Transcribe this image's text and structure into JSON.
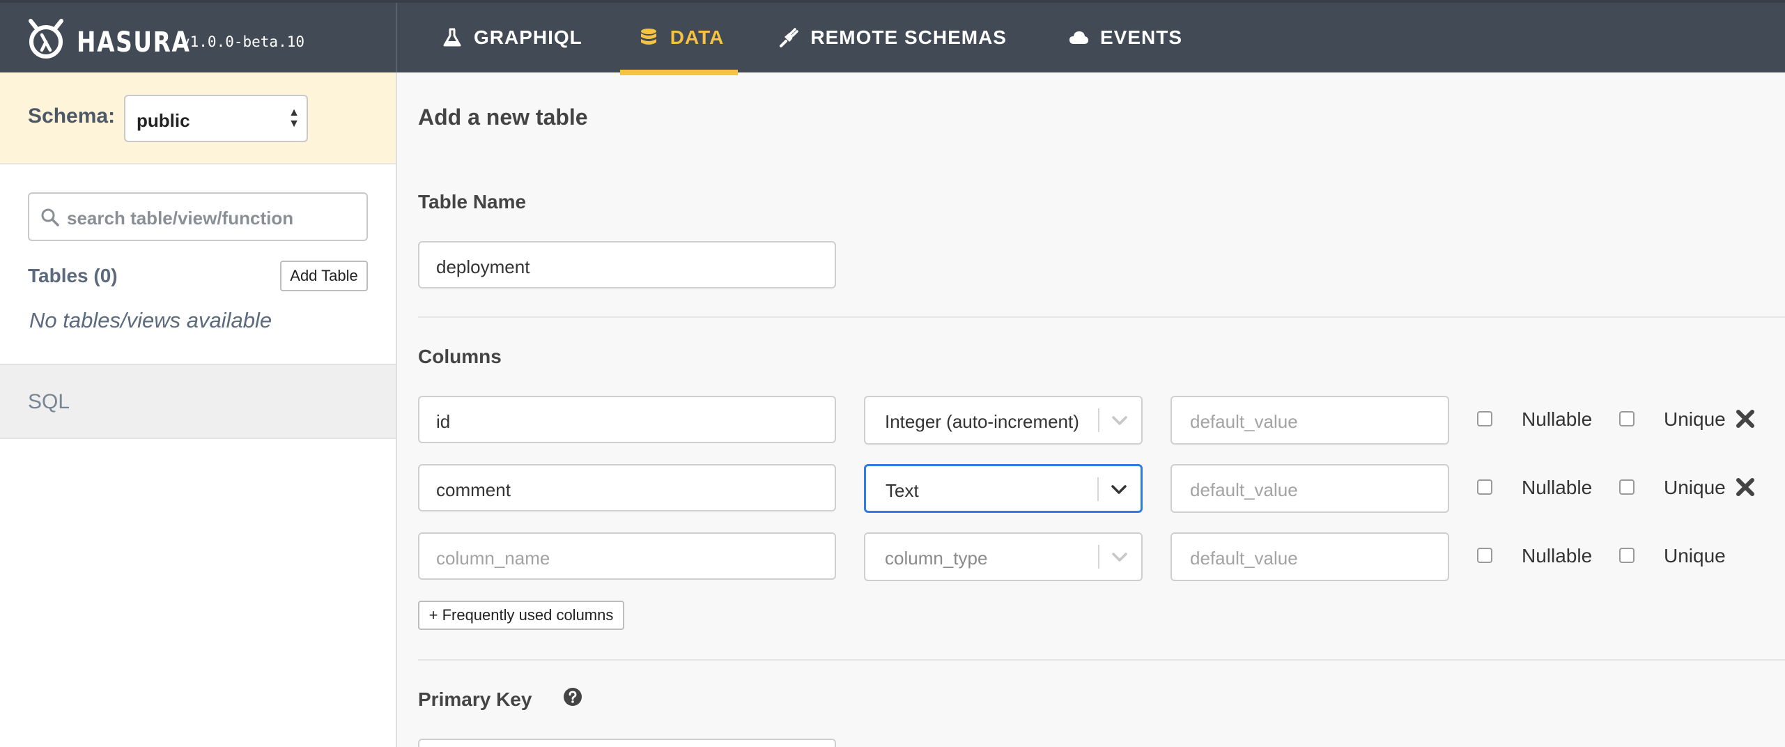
{
  "brand": {
    "name": "HASURA",
    "version": "v1.0.0-beta.10"
  },
  "nav": [
    {
      "label": "GRAPHIQL",
      "icon": "flask-icon",
      "active": false
    },
    {
      "label": "DATA",
      "icon": "database-icon",
      "active": true
    },
    {
      "label": "REMOTE SCHEMAS",
      "icon": "plug-icon",
      "active": false
    },
    {
      "label": "EVENTS",
      "icon": "cloud-icon",
      "active": false
    }
  ],
  "colors": {
    "topbar": "#424a56",
    "accent": "#f5c242",
    "schema_bar": "#fdf4d9",
    "focus": "#2f7de1"
  },
  "sidebar": {
    "schema_label": "Schema:",
    "schema_value": "public",
    "search_placeholder": "search table/view/function",
    "tables_label": "Tables (0)",
    "add_table": "Add Table",
    "empty_message": "No tables/views available",
    "sql_label": "SQL"
  },
  "main": {
    "title": "Add a new table",
    "table_name_label": "Table Name",
    "table_name_value": "deployment",
    "columns_label": "Columns",
    "columns": [
      {
        "name": "id",
        "type": "Integer (auto-increment)",
        "default_placeholder": "default_value",
        "nullable_label": "Nullable",
        "unique_label": "Unique"
      },
      {
        "name": "comment",
        "type": "Text",
        "default_placeholder": "default_value",
        "nullable_label": "Nullable",
        "unique_label": "Unique"
      },
      {
        "name_placeholder": "column_name",
        "type_placeholder": "column_type",
        "default_placeholder": "default_value",
        "nullable_label": "Nullable",
        "unique_label": "Unique"
      }
    ],
    "frequent_columns_button": "+ Frequently used columns",
    "primary_key_label": "Primary Key"
  }
}
